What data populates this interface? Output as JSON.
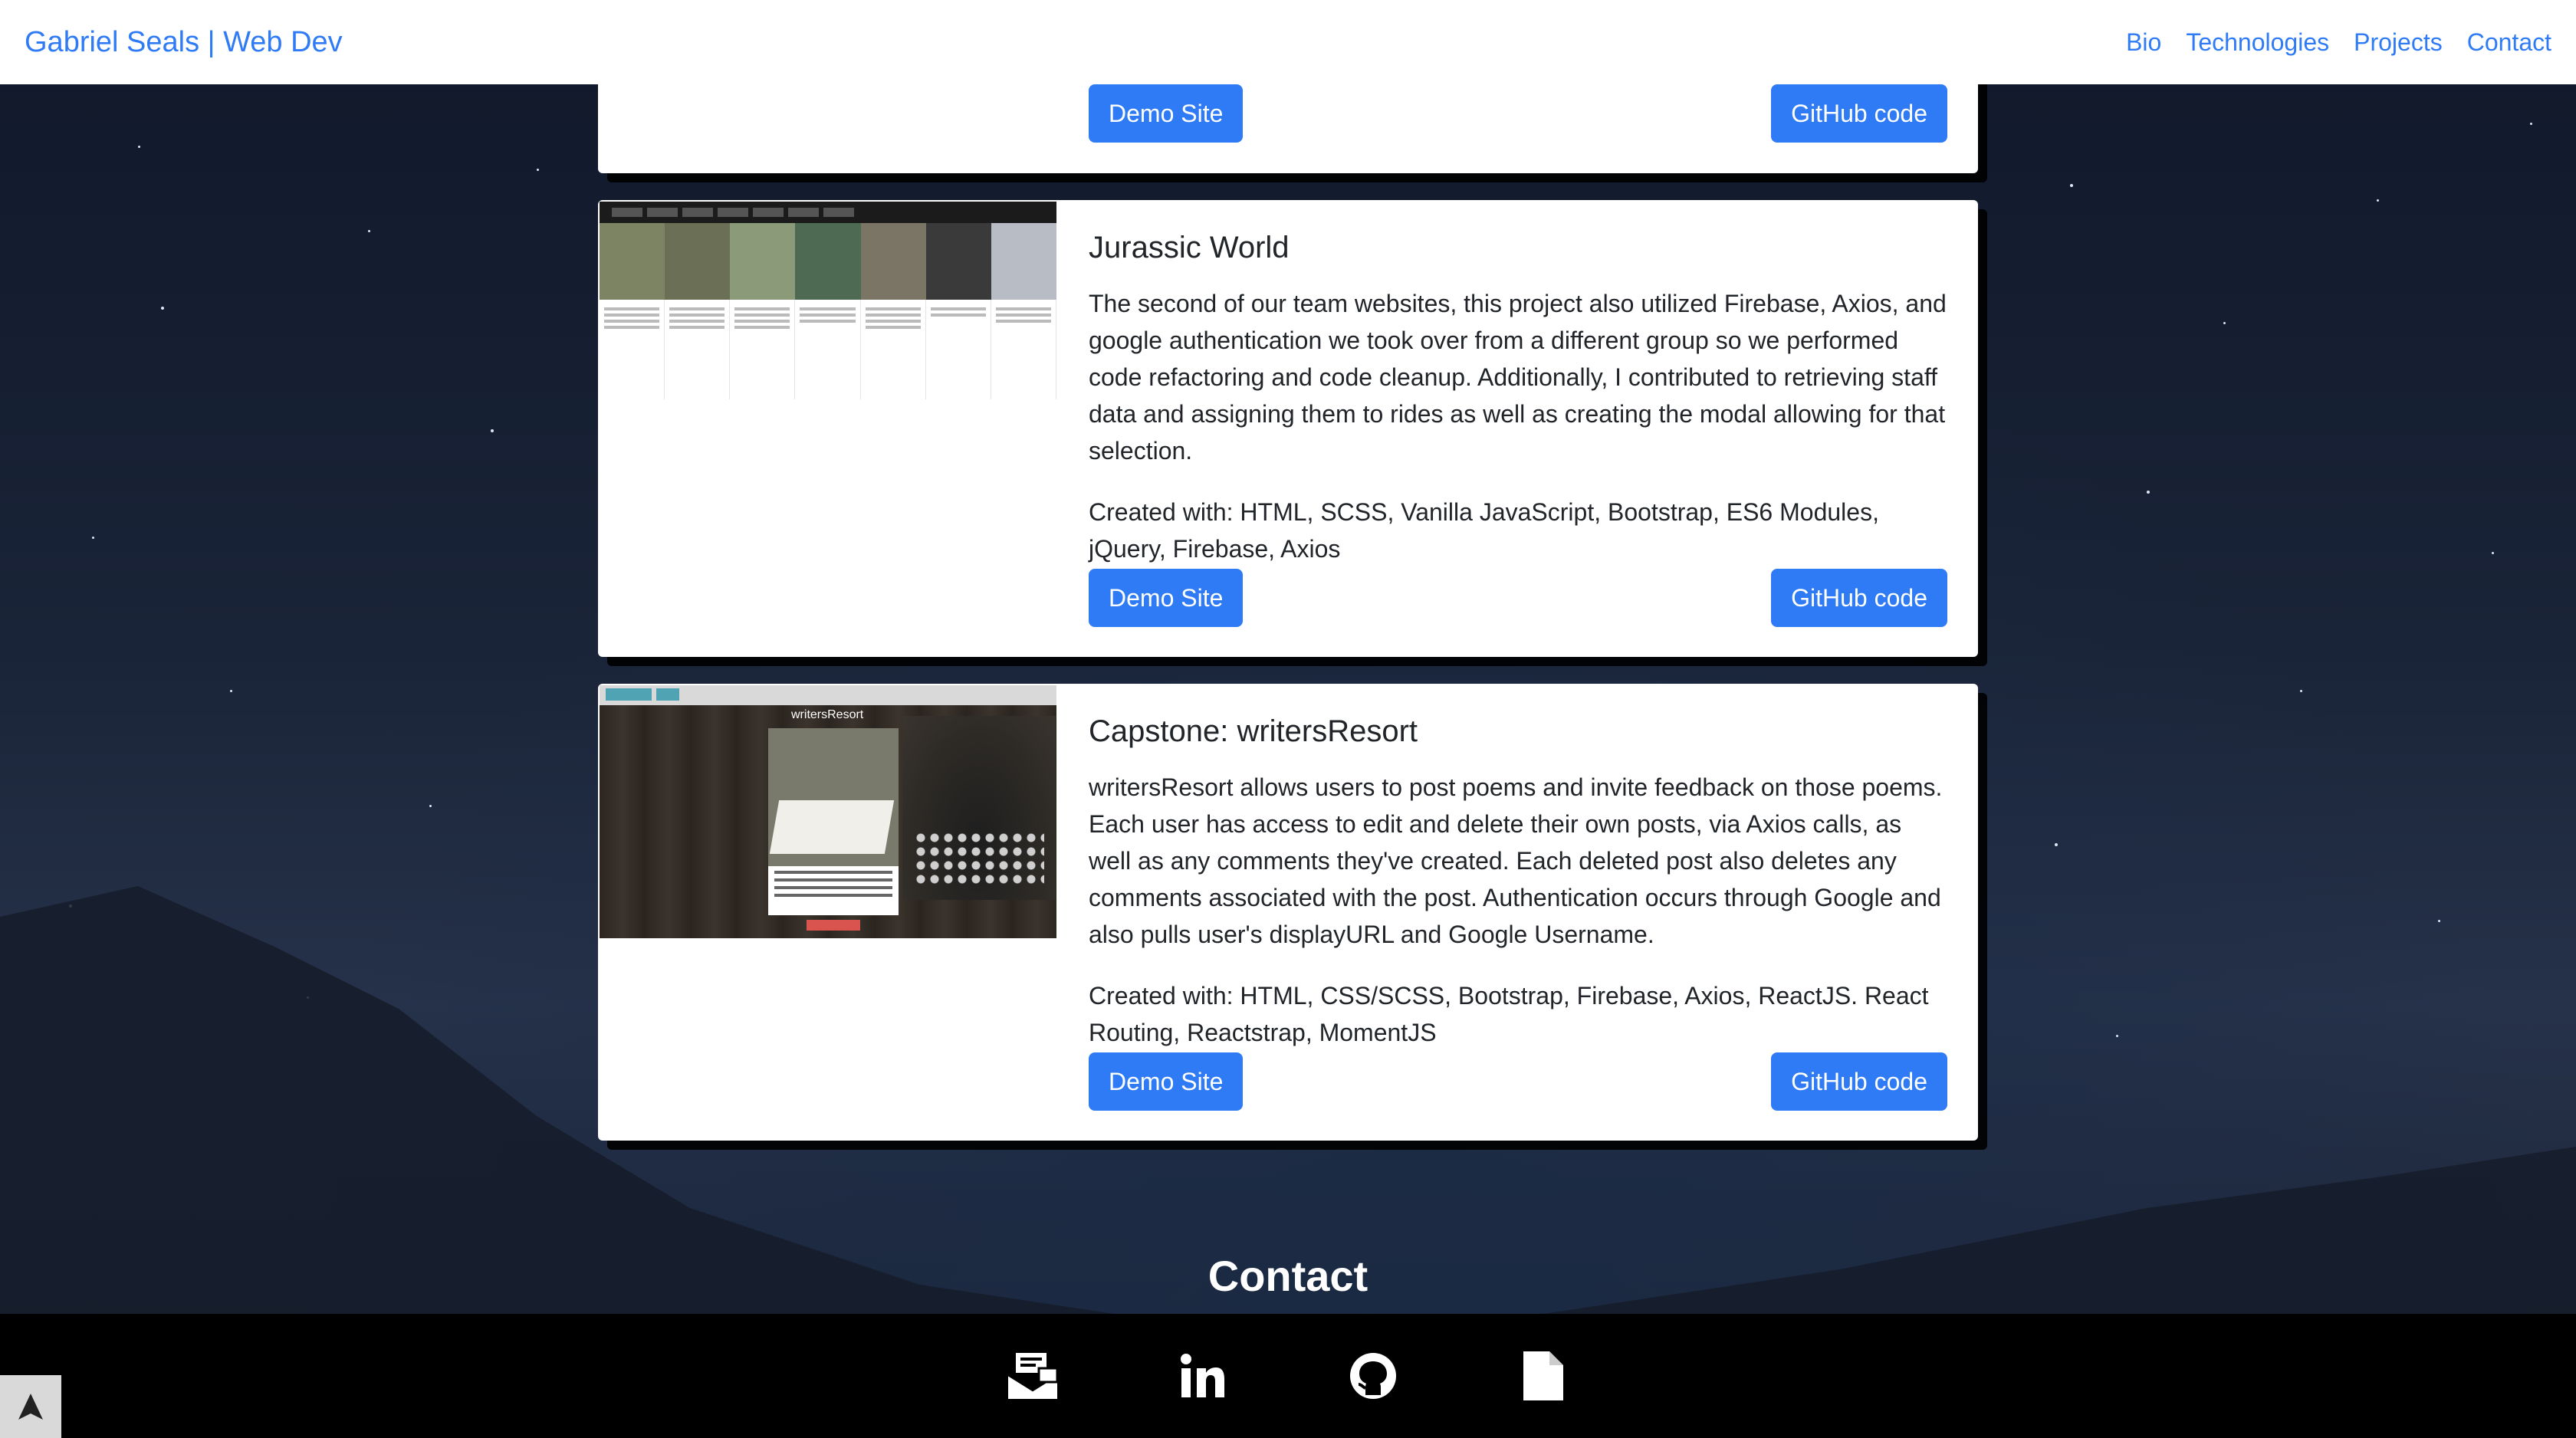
{
  "header": {
    "brand": "Gabriel Seals | Web Dev",
    "nav": [
      "Bio",
      "Technologies",
      "Projects",
      "Contact"
    ]
  },
  "projects": [
    {
      "demo_label": "Demo Site",
      "github_label": "GitHub code"
    },
    {
      "title": "Jurassic World",
      "description": "The second of our team websites, this project also utilized Firebase, Axios, and google authentication we took over from a different group so we performed code refactoring and code cleanup. Additionally, I contributed to retrieving staff data and assigning them to rides as well as creating the modal allowing for that selection.",
      "tech": "Created with: HTML, SCSS, Vanilla JavaScript, Bootstrap, ES6 Modules, jQuery, Firebase, Axios",
      "demo_label": "Demo Site",
      "github_label": "GitHub code"
    },
    {
      "title": "Capstone: writersResort",
      "description": "writersResort allows users to post poems and invite feedback on those poems. Each user has access to edit and delete their own posts, via Axios calls, as well as any comments they've created. Each deleted post also deletes any comments associated with the post. Authentication occurs through Google and also pulls user's displayURL and Google Username.",
      "tech": "Created with: HTML, CSS/SCSS, Bootstrap, Firebase, Axios, ReactJS. React Routing, Reactstrap, MomentJS",
      "demo_label": "Demo Site",
      "github_label": "GitHub code",
      "thumbnail_title": "writersResort"
    }
  ],
  "contact": {
    "heading": "Contact",
    "icons": [
      "email-icon",
      "linkedin-icon",
      "github-icon",
      "resume-icon"
    ]
  },
  "colors": {
    "accent": "#2f7bf5",
    "footer": "#000000"
  }
}
